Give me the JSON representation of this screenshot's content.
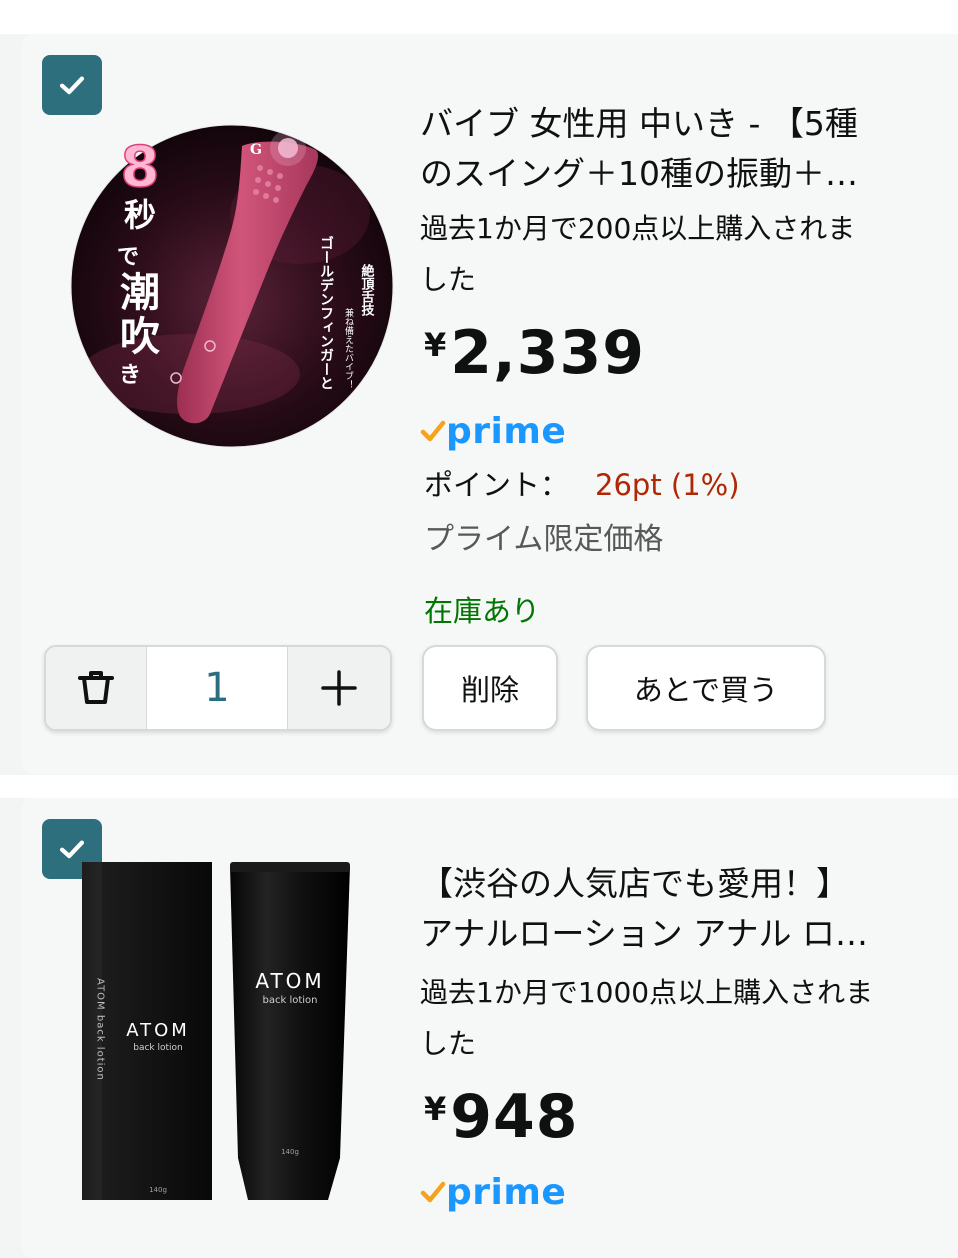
{
  "items": [
    {
      "checked": true,
      "title_line1": "バイブ 女性用 中いき - 【5種",
      "title_line2": "のスイング＋10種の振動＋…",
      "bought_line1": "過去1か月で200点以上購入されま",
      "bought_line2": "した",
      "currency": "¥",
      "price": "2,339",
      "prime_label": "prime",
      "points_label": "ポイント：",
      "points_value": "26pt (1%)",
      "limited_label": "プライム限定価格",
      "stock_label": "在庫あり",
      "quantity": "1",
      "delete_label": "削除",
      "save_later_label": "あとで買う",
      "image_text": {
        "big_number": "8",
        "vertical_caption_chars": [
          "秒",
          "で",
          "潮",
          "吹",
          "き"
        ],
        "sub_caption_1": "絶頂舌技",
        "sub_caption_2": "ゴールデンフィンガーと",
        "sub_caption_3": "兼ね備えたバイブ！",
        "logo_letter": "G"
      }
    },
    {
      "checked": true,
      "title_line1": "【渋谷の人気店でも愛用！】",
      "title_line2": "アナルローション アナル ロ…",
      "bought_line1": "過去1か月で1000点以上購入されま",
      "bought_line2": "した",
      "currency": "¥",
      "price": "948",
      "prime_label": "prime",
      "image_text": {
        "brand": "ATOM",
        "sub": "back lotion",
        "side_text": "ATOM back lotion",
        "net": "140g"
      }
    }
  ],
  "colors": {
    "checkbox": "#2e6f7e",
    "prime_blue": "#1a98ff",
    "prime_check": "#f7a21d",
    "points_red": "#b12704",
    "stock_green": "#007600",
    "product_pink": "#c2466e"
  },
  "icons": [
    "check-icon",
    "trash-icon",
    "plus-icon",
    "prime-check-icon"
  ]
}
